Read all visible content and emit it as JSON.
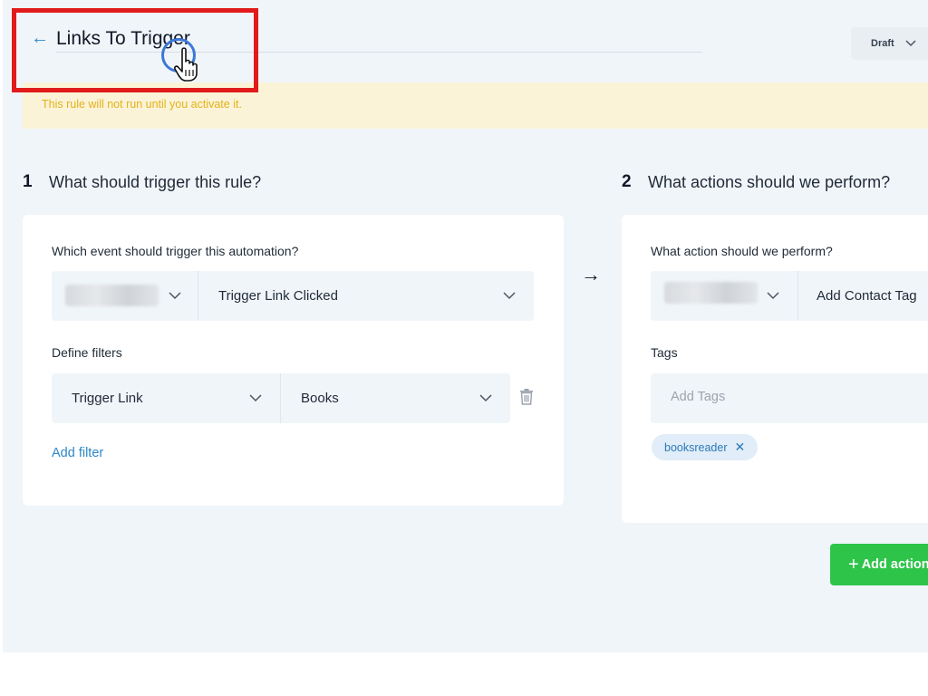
{
  "header": {
    "back_icon": "arrow-left-icon",
    "title": "Links To Trigger",
    "status": {
      "label": "Draft",
      "icon": "chevron-down-icon"
    }
  },
  "warning": {
    "text": "This rule will not run until you activate it."
  },
  "trigger_section": {
    "number": "1",
    "title": "What should trigger this rule?",
    "event_label": "Which event should trigger this automation?",
    "event_app_value": "",
    "event_value": "Trigger Link Clicked",
    "filters_label": "Define filters",
    "filter": {
      "field": "Trigger Link",
      "value": "Books"
    },
    "add_filter_label": "Add filter"
  },
  "between_arrow": "→",
  "action_section": {
    "number": "2",
    "title": "What actions should we perform?",
    "action_label": "What action should we perform?",
    "action_app_value": "",
    "action_value": "Add Contact Tag",
    "tags_label": "Tags",
    "tags_placeholder": "Add Tags",
    "tags": [
      "booksreader"
    ],
    "add_action_label": "Add action"
  },
  "colors": {
    "accent_blue": "#2d88c9",
    "highlight_red": "#e11b1b",
    "warning_bg": "#fbf3d8",
    "warning_text": "#e3b219",
    "add_button_green": "#2ec44a",
    "page_bg": "#f0f5f9"
  }
}
